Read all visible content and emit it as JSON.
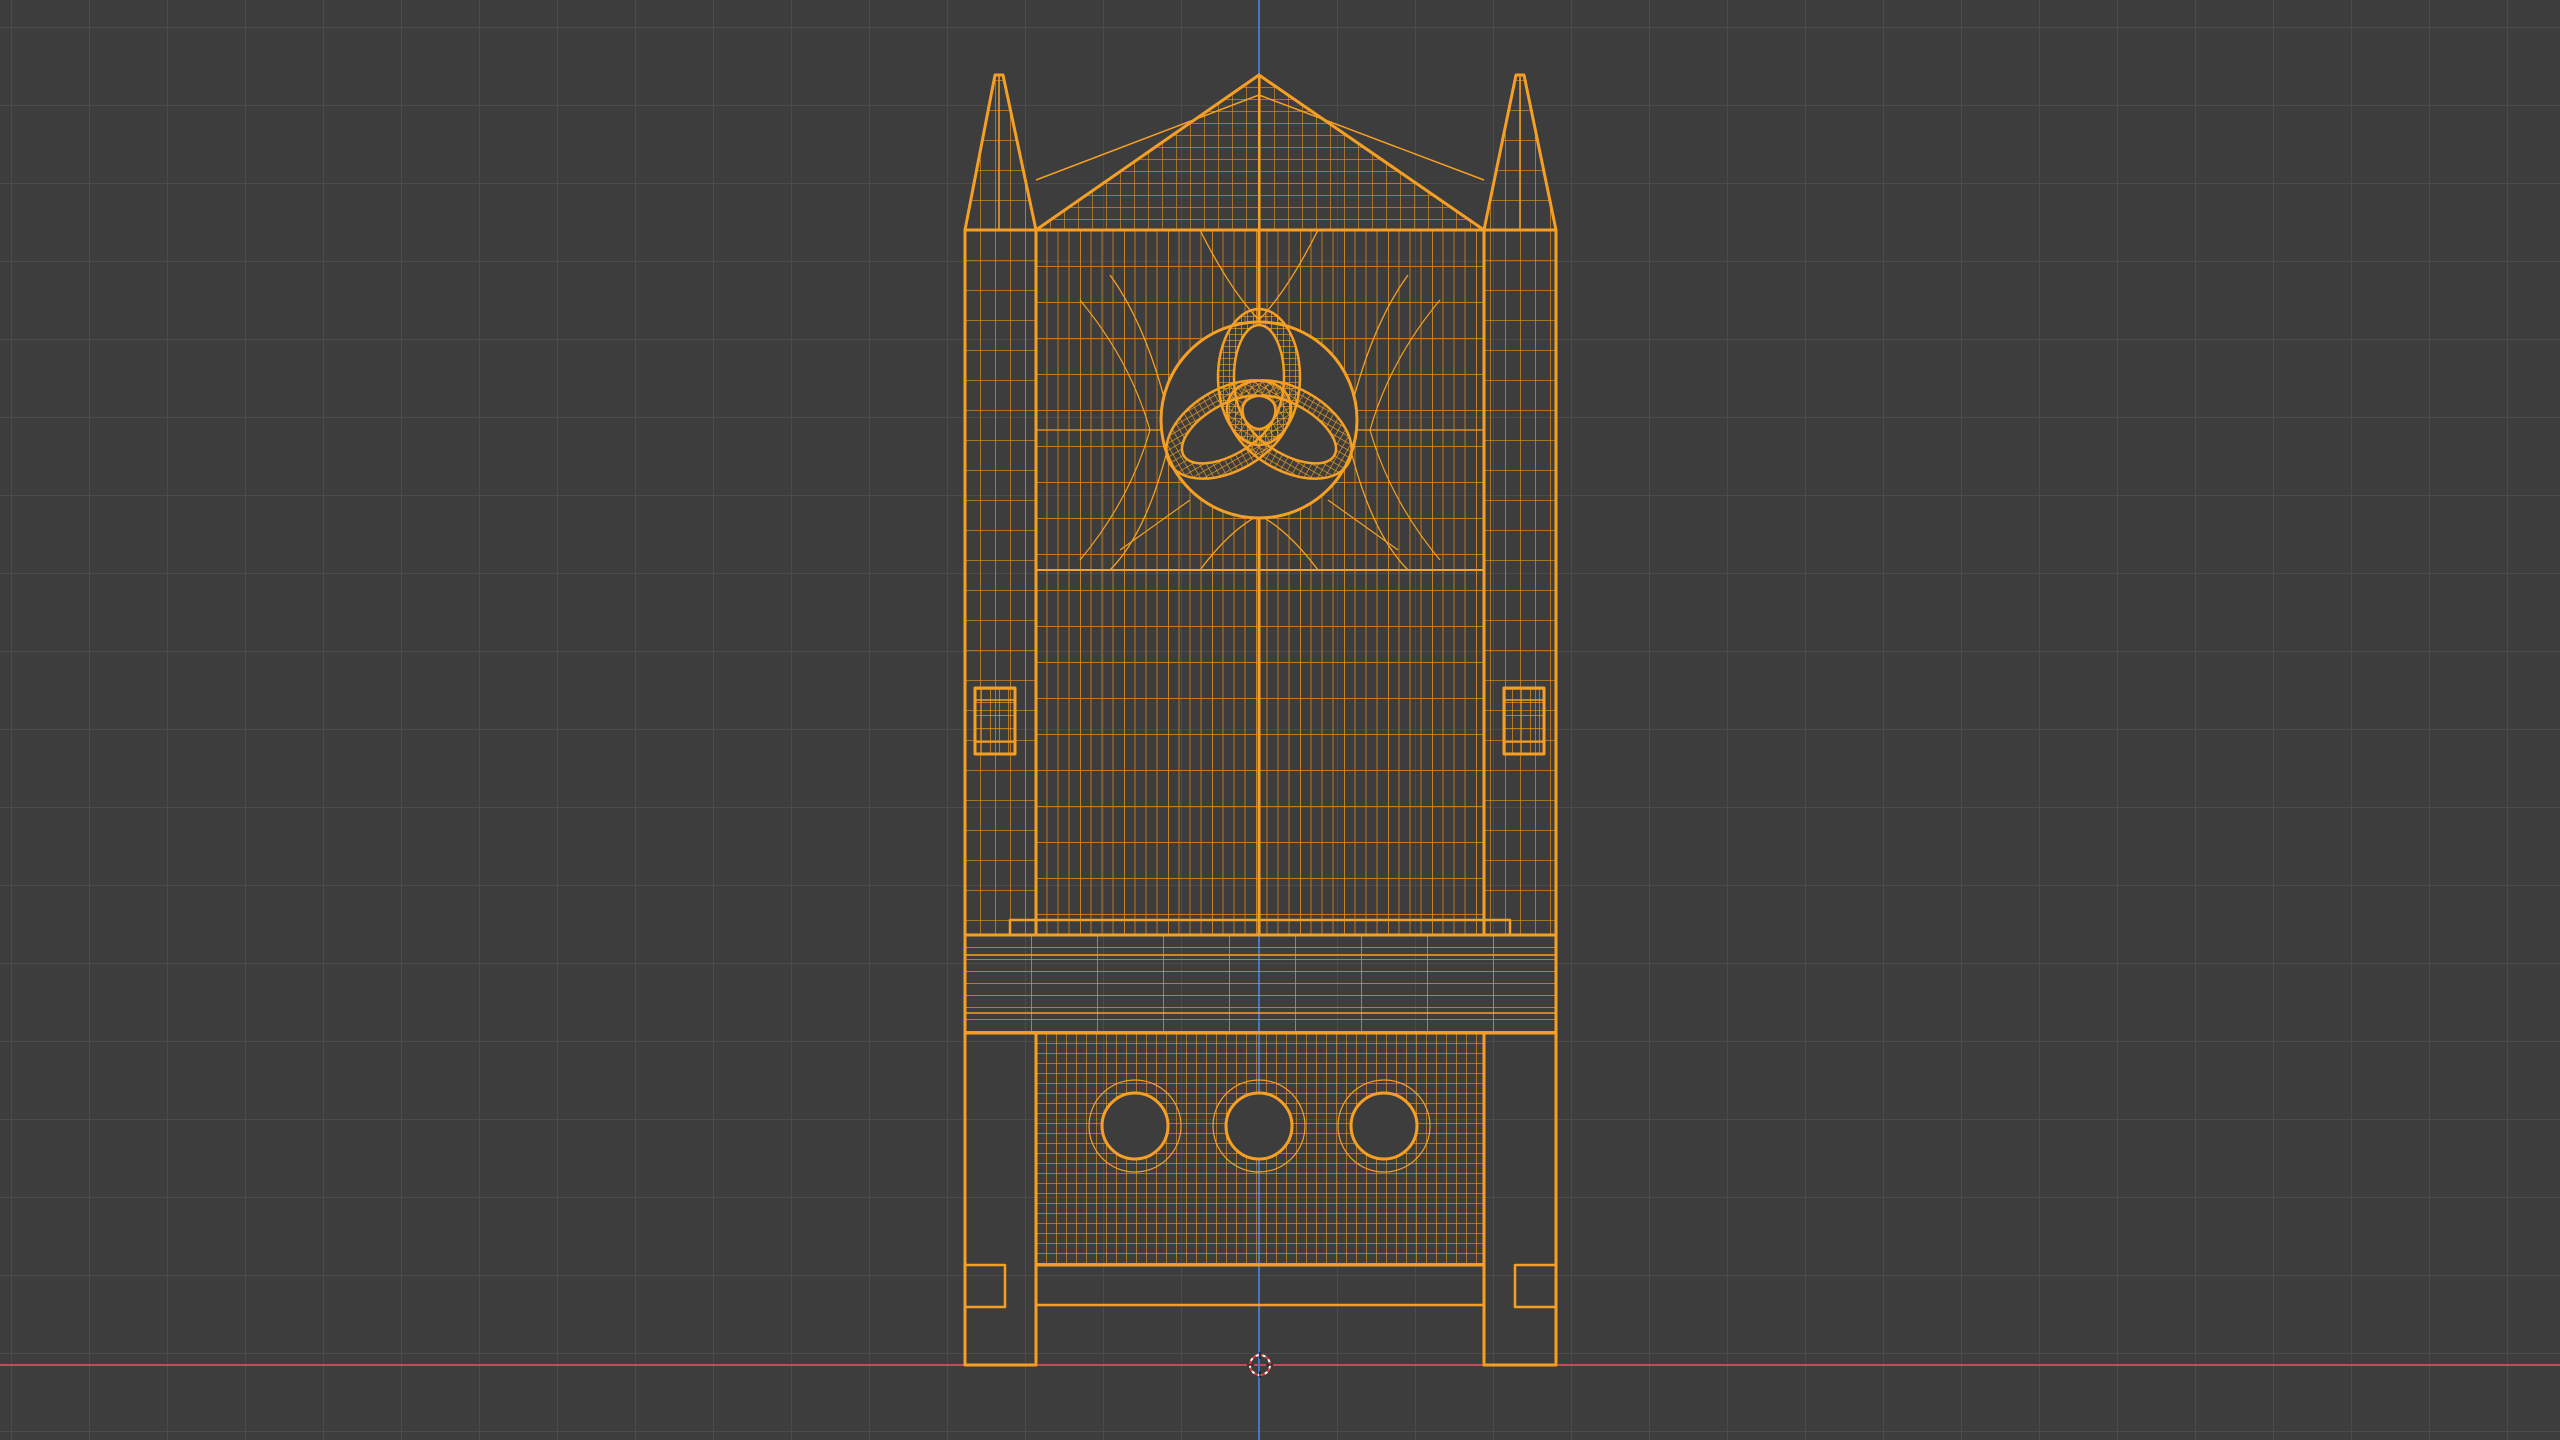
{
  "app": "Blender",
  "view": {
    "mode": "wireframe",
    "projection": "orthographic-front",
    "selection_state": "selected",
    "background_color": "#3d3d3d",
    "grid_color": "#4c4c4c",
    "axis_x_color": "#d0485a",
    "axis_z_color": "#4a7fd4",
    "wire_color": "#f5a024",
    "wire_dense_color": "#e08a18"
  },
  "scene": {
    "object_name": "gothic-cabinet-with-trinity-knot",
    "parts": [
      {
        "name": "left-spire-icon"
      },
      {
        "name": "right-spire-icon"
      },
      {
        "name": "gable-roof-icon"
      },
      {
        "name": "trinity-knot-icon"
      },
      {
        "name": "left-hinge-icon"
      },
      {
        "name": "right-hinge-icon"
      },
      {
        "name": "drawer-band-icon"
      },
      {
        "name": "three-hole-panel-icon"
      }
    ]
  },
  "cursor": {
    "icon": "3d-cursor-icon"
  }
}
